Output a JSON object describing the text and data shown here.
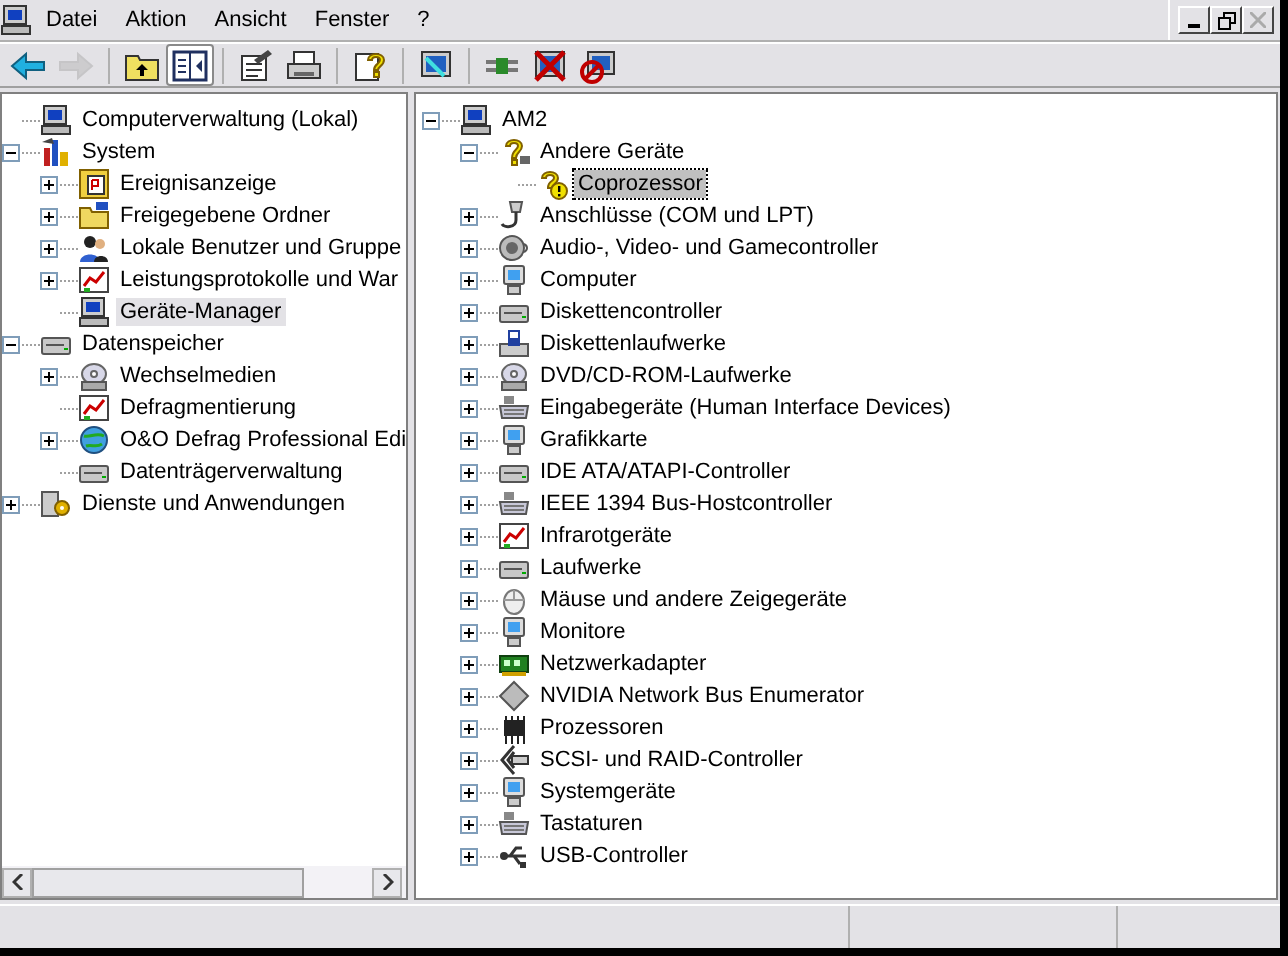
{
  "menu": [
    {
      "label": "Datei"
    },
    {
      "label": "Aktion"
    },
    {
      "label": "Ansicht"
    },
    {
      "label": "Fenster"
    },
    {
      "label": "?"
    }
  ],
  "window_controls": [
    {
      "kind": "minimize",
      "disabled": false
    },
    {
      "kind": "restore",
      "disabled": false
    },
    {
      "kind": "close",
      "disabled": true
    }
  ],
  "toolbar": [
    {
      "kind": "back",
      "disabled": false,
      "pressed": false
    },
    {
      "kind": "forward",
      "disabled": true,
      "pressed": false
    },
    {
      "kind": "separator"
    },
    {
      "kind": "up",
      "disabled": false,
      "pressed": false
    },
    {
      "kind": "tree",
      "disabled": false,
      "pressed": true
    },
    {
      "kind": "separator"
    },
    {
      "kind": "properties",
      "disabled": false,
      "pressed": false
    },
    {
      "kind": "print",
      "disabled": false,
      "pressed": false
    },
    {
      "kind": "separator"
    },
    {
      "kind": "help",
      "disabled": false,
      "pressed": false
    },
    {
      "kind": "separator"
    },
    {
      "kind": "scan",
      "disabled": false,
      "pressed": false
    },
    {
      "kind": "separator"
    },
    {
      "kind": "update",
      "disabled": false,
      "pressed": false
    },
    {
      "kind": "uninstall",
      "disabled": false,
      "pressed": false
    },
    {
      "kind": "disable",
      "disabled": false,
      "pressed": false
    }
  ],
  "console_tree": [
    {
      "label": "Computerverwaltung (Lokal)",
      "kind": "computer",
      "has_children": false,
      "selected": false
    },
    {
      "label": "System",
      "kind": "tools",
      "has_children": true,
      "expanded": true,
      "selected": false,
      "children": [
        {
          "label": "Ereignisanzeige",
          "kind": "log",
          "has_children": true,
          "expanded": false,
          "selected": false
        },
        {
          "label": "Freigegebene Ordner",
          "kind": "folder",
          "has_children": true,
          "expanded": false,
          "selected": false
        },
        {
          "label": "Lokale Benutzer und Gruppe",
          "kind": "users",
          "has_children": true,
          "expanded": false,
          "selected": false
        },
        {
          "label": "Leistungsprotokolle und War",
          "kind": "chart",
          "has_children": true,
          "expanded": false,
          "selected": false
        },
        {
          "label": "Geräte-Manager",
          "kind": "computer",
          "has_children": false,
          "selected": true
        }
      ]
    },
    {
      "label": "Datenspeicher",
      "kind": "drive",
      "has_children": true,
      "expanded": true,
      "selected": false,
      "children": [
        {
          "label": "Wechselmedien",
          "kind": "disc",
          "has_children": true,
          "expanded": false,
          "selected": false
        },
        {
          "label": "Defragmentierung",
          "kind": "chart",
          "has_children": false,
          "selected": false
        },
        {
          "label": "O&O Defrag Professional Edi",
          "kind": "globe",
          "has_children": true,
          "expanded": false,
          "selected": false
        },
        {
          "label": "Datenträgerverwaltung",
          "kind": "drive",
          "has_children": false,
          "selected": false
        }
      ]
    },
    {
      "label": "Dienste und Anwendungen",
      "kind": "gears",
      "has_children": true,
      "expanded": false,
      "selected": false
    }
  ],
  "device_tree": [
    {
      "label": "AM2",
      "kind": "computer",
      "has_children": true,
      "expanded": true,
      "selected": false,
      "children": [
        {
          "label": "Andere Geräte",
          "kind": "question",
          "has_children": true,
          "expanded": true,
          "selected": false,
          "children": [
            {
              "label": "Coprozessor",
              "kind": "warning",
              "has_children": false,
              "selected": true
            }
          ]
        },
        {
          "label": "Anschlüsse (COM und LPT)",
          "kind": "plug",
          "has_children": true,
          "expanded": false,
          "selected": false
        },
        {
          "label": "Audio-, Video- und Gamecontroller",
          "kind": "speaker",
          "has_children": true,
          "expanded": false,
          "selected": false
        },
        {
          "label": "Computer",
          "kind": "monitor",
          "has_children": true,
          "expanded": false,
          "selected": false
        },
        {
          "label": "Diskettencontroller",
          "kind": "drive",
          "has_children": true,
          "expanded": false,
          "selected": false
        },
        {
          "label": "Diskettenlaufwerke",
          "kind": "floppy",
          "has_children": true,
          "expanded": false,
          "selected": false
        },
        {
          "label": "DVD/CD-ROM-Laufwerke",
          "kind": "disc",
          "has_children": true,
          "expanded": false,
          "selected": false
        },
        {
          "label": "Eingabegeräte (Human Interface Devices)",
          "kind": "keyboard",
          "has_children": true,
          "expanded": false,
          "selected": false
        },
        {
          "label": "Grafikkarte",
          "kind": "monitor",
          "has_children": true,
          "expanded": false,
          "selected": false
        },
        {
          "label": "IDE ATA/ATAPI-Controller",
          "kind": "drive",
          "has_children": true,
          "expanded": false,
          "selected": false
        },
        {
          "label": "IEEE 1394 Bus-Hostcontroller",
          "kind": "keyboard",
          "has_children": true,
          "expanded": false,
          "selected": false
        },
        {
          "label": "Infrarotgeräte",
          "kind": "chart",
          "has_children": true,
          "expanded": false,
          "selected": false
        },
        {
          "label": "Laufwerke",
          "kind": "drive",
          "has_children": true,
          "expanded": false,
          "selected": false
        },
        {
          "label": "Mäuse und andere Zeigegeräte",
          "kind": "mouse",
          "has_children": true,
          "expanded": false,
          "selected": false
        },
        {
          "label": "Monitore",
          "kind": "monitor",
          "has_children": true,
          "expanded": false,
          "selected": false
        },
        {
          "label": "Netzwerkadapter",
          "kind": "netcard",
          "has_children": true,
          "expanded": false,
          "selected": false
        },
        {
          "label": "NVIDIA Network Bus Enumerator",
          "kind": "diamond",
          "has_children": true,
          "expanded": false,
          "selected": false
        },
        {
          "label": "Prozessoren",
          "kind": "chip",
          "has_children": true,
          "expanded": false,
          "selected": false
        },
        {
          "label": "SCSI- und RAID-Controller",
          "kind": "scsi",
          "has_children": true,
          "expanded": false,
          "selected": false
        },
        {
          "label": "Systemgeräte",
          "kind": "monitor",
          "has_children": true,
          "expanded": false,
          "selected": false
        },
        {
          "label": "Tastaturen",
          "kind": "keyboard",
          "has_children": true,
          "expanded": false,
          "selected": false
        },
        {
          "label": "USB-Controller",
          "kind": "usb",
          "has_children": true,
          "expanded": false,
          "selected": false
        }
      ]
    }
  ]
}
